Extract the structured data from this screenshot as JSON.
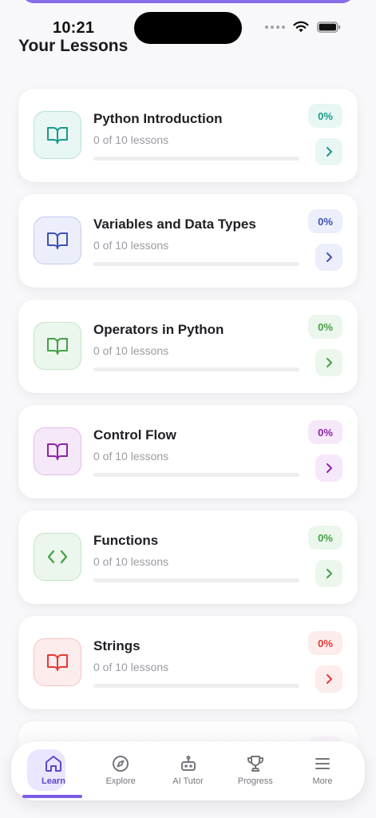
{
  "status_bar": {
    "time": "10:21"
  },
  "page": {
    "title": "Your Lessons"
  },
  "lessons": [
    {
      "title": "Python Introduction",
      "subtitle": "0 of 10 lessons",
      "percent": "0%",
      "progress": 0,
      "icon": "book-icon",
      "accent": "#1a9a8a",
      "bg": "#e8f6f4",
      "border": "#b7e2dc"
    },
    {
      "title": "Variables and Data Types",
      "subtitle": "0 of 10 lessons",
      "percent": "0%",
      "progress": 0,
      "icon": "book-icon",
      "accent": "#3f51b5",
      "bg": "#eceefb",
      "border": "#c5cbee"
    },
    {
      "title": "Operators in Python",
      "subtitle": "0 of 10 lessons",
      "percent": "0%",
      "progress": 0,
      "icon": "book-icon",
      "accent": "#43a047",
      "bg": "#ebf6ec",
      "border": "#c3e4c5"
    },
    {
      "title": "Control Flow",
      "subtitle": "0 of 10 lessons",
      "percent": "0%",
      "progress": 0,
      "icon": "book-icon",
      "accent": "#8e24aa",
      "bg": "#f5e8f8",
      "border": "#e0bdea"
    },
    {
      "title": "Functions",
      "subtitle": "0 of 10 lessons",
      "percent": "0%",
      "progress": 0,
      "icon": "code-icon",
      "accent": "#43a047",
      "bg": "#ebf6ec",
      "border": "#c3e4c5"
    },
    {
      "title": "Strings",
      "subtitle": "0 of 10 lessons",
      "percent": "0%",
      "progress": 0,
      "icon": "book-icon",
      "accent": "#e53935",
      "bg": "#fdecec",
      "border": "#f5c4c3"
    }
  ],
  "partial_card": {
    "accent": "#8e24aa",
    "bg": "#f5e8f8"
  },
  "tabbar": {
    "tabs": [
      {
        "label": "Learn",
        "icon": "home-icon",
        "active": true
      },
      {
        "label": "Explore",
        "icon": "compass-icon",
        "active": false
      },
      {
        "label": "AI Tutor",
        "icon": "robot-icon",
        "active": false
      },
      {
        "label": "Progress",
        "icon": "trophy-icon",
        "active": false
      },
      {
        "label": "More",
        "icon": "menu-icon",
        "active": false
      }
    ],
    "active_color": "#5a48c8",
    "inactive_color": "#76767e"
  }
}
